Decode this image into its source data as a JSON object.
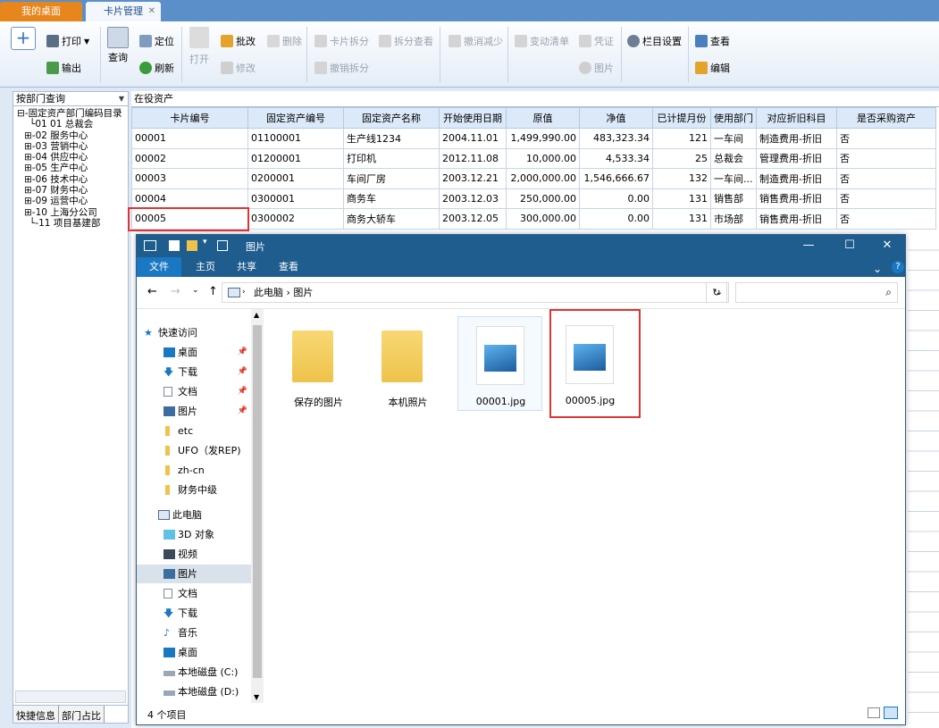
{
  "tabs": {
    "home": "我的桌面",
    "card": "卡片管理",
    "close": "✕"
  },
  "toolbar": {
    "print": "打印",
    "export": "输出",
    "query": "查询",
    "locate": "定位",
    "refresh": "刷新",
    "open": "打开",
    "batch_edit": "批改",
    "modify": "修改",
    "delete": "删除",
    "card_split": "卡片拆分",
    "undo_split": "撤销拆分",
    "split_view": "拆分查看",
    "undo_reduce": "撤消减少",
    "change_list": "变动清单",
    "voucher": "凭证",
    "picture": "图片",
    "column_settings": "栏目设置",
    "view": "查看",
    "edit": "编辑"
  },
  "left_panel": {
    "dropdown": "按部门查询",
    "tree_root": "固定资产部门编码目录",
    "departments": [
      "01 总裁会",
      "02 服务中心",
      "03 营销中心",
      "04 供应中心",
      "05 生产中心",
      "06 技术中心",
      "07 财务中心",
      "09 运营中心",
      "10 上海分公司",
      "11 项目基建部"
    ],
    "bottom_tabs": [
      "快捷信息",
      "部门占比"
    ]
  },
  "grid": {
    "caption": "在役资产",
    "headers": [
      "卡片编号",
      "固定资产编号",
      "固定资产名称",
      "开始使用日期",
      "原值",
      "净值",
      "已计提月份",
      "使用部门",
      "对应折旧科目",
      "是否采购资产"
    ],
    "rows": [
      [
        "00001",
        "01100001",
        "生产线1234",
        "2004.11.01",
        "1,499,990.00",
        "483,323.34",
        "121",
        "一车间",
        "制造费用-折旧",
        "否"
      ],
      [
        "00002",
        "01200001",
        "打印机",
        "2012.11.08",
        "10,000.00",
        "4,533.34",
        "25",
        "总裁会",
        "管理费用-折旧",
        "否"
      ],
      [
        "00003",
        "0200001",
        "车间厂房",
        "2003.12.21",
        "2,000,000.00",
        "1,546,666.67",
        "132",
        "一车间...",
        "制造费用-折旧",
        "否"
      ],
      [
        "00004",
        "0300001",
        "商务车",
        "2003.12.03",
        "250,000.00",
        "0.00",
        "131",
        "销售部",
        "销售费用-折旧",
        "否"
      ],
      [
        "00005",
        "0300002",
        "商务大轿车",
        "2003.12.05",
        "300,000.00",
        "0.00",
        "131",
        "市场部",
        "销售费用-折旧",
        "否"
      ]
    ]
  },
  "explorer": {
    "title": "图片",
    "menu": [
      "文件",
      "主页",
      "共享",
      "查看"
    ],
    "path": [
      "此电脑",
      "图片"
    ],
    "nav": {
      "quick_access": "快速访问",
      "pinned": [
        "桌面",
        "下载",
        "文档",
        "图片"
      ],
      "folders": [
        "etc",
        "UFO（发REP)",
        "zh-cn",
        "财务中级"
      ],
      "this_pc": "此电脑",
      "pc_items": [
        "3D 对象",
        "视频",
        "图片",
        "文档",
        "下载",
        "音乐",
        "桌面",
        "本地磁盘 (C:)",
        "本地磁盘 (D:)"
      ]
    },
    "files": [
      "保存的图片",
      "本机照片",
      "00001.jpg",
      "00005.jpg"
    ],
    "status": "4 个项目"
  }
}
